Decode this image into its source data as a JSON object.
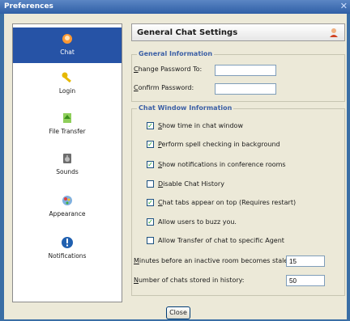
{
  "window": {
    "title": "Preferences",
    "close_glyph": "✕"
  },
  "sidebar": {
    "items": [
      {
        "label": "Chat",
        "icon": "chat-icon",
        "selected": true
      },
      {
        "label": "Login",
        "icon": "key-icon"
      },
      {
        "label": "File Transfer",
        "icon": "file-transfer-icon"
      },
      {
        "label": "Sounds",
        "icon": "speaker-icon"
      },
      {
        "label": "Appearance",
        "icon": "appearance-icon"
      },
      {
        "label": "Notifications",
        "icon": "info-icon"
      }
    ]
  },
  "header": {
    "title": "General Chat Settings",
    "icon": "user-icon"
  },
  "general": {
    "title": "General Information",
    "change_password_label": "Change Password To:",
    "change_password_value": "",
    "confirm_password_label": "Confirm Password:",
    "confirm_password_value": ""
  },
  "chatwin": {
    "title": "Chat Window Information",
    "options": [
      {
        "label": "Show time in chat window",
        "checked": true
      },
      {
        "label": "Perform spell checking in background",
        "checked": true
      },
      {
        "label": "Show notifications in conference rooms",
        "checked": true
      },
      {
        "label": "Disable Chat History",
        "checked": false
      },
      {
        "label": "Chat tabs appear on top (Requires restart)",
        "checked": true
      },
      {
        "label": "Allow users to buzz you.",
        "checked": true
      },
      {
        "label": "Allow Transfer of chat to specific Agent",
        "checked": false
      }
    ],
    "stale_label": "Minutes before an inactive room becomes stale:",
    "stale_value": "15",
    "history_label": "Number of chats stored in history:",
    "history_value": "50"
  },
  "footer": {
    "close_label": "Close"
  },
  "colors": {
    "selected": "#2653a6",
    "group_title": "#3b5fa5",
    "check": "#21a121"
  }
}
